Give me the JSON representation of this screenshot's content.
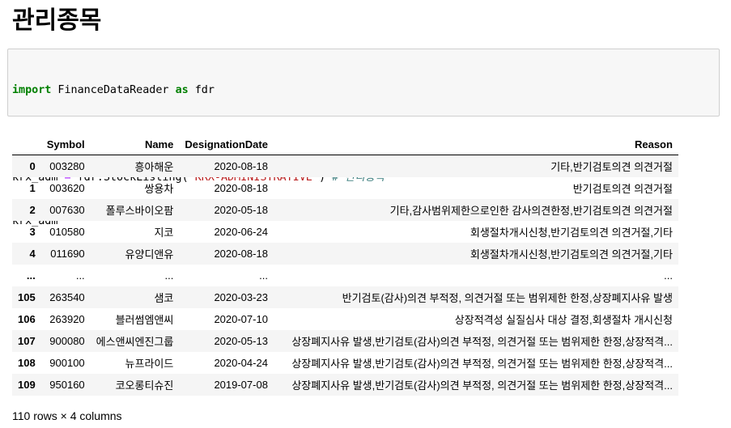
{
  "heading": "관리종목",
  "code": {
    "line1": {
      "kw": "import",
      "mod": " FinanceDataReader ",
      "kw2": "as",
      "alias": " fdr"
    },
    "line3": {
      "var": "krx_adm ",
      "eq": "=",
      "call": " fdr.StockListing(",
      "str": "'KRX-ADMINISTRATIVE'",
      "close": ") ",
      "comment": "# 관리종목"
    },
    "line4": "krx_adm"
  },
  "table": {
    "columns": [
      "",
      "Symbol",
      "Name",
      "DesignationDate",
      "Reason"
    ],
    "rows": [
      {
        "idx": "0",
        "symbol": "003280",
        "name": "흥아해운",
        "date": "2020-08-18",
        "reason": "기타,반기검토의견 의견거절"
      },
      {
        "idx": "1",
        "symbol": "003620",
        "name": "쌍용차",
        "date": "2020-08-18",
        "reason": "반기검토의견 의견거절"
      },
      {
        "idx": "2",
        "symbol": "007630",
        "name": "폴루스바이오팜",
        "date": "2020-05-18",
        "reason": "기타,감사범위제한으로인한 감사의견한정,반기검토의견 의견거절"
      },
      {
        "idx": "3",
        "symbol": "010580",
        "name": "지코",
        "date": "2020-06-24",
        "reason": "회생절차개시신청,반기검토의견 의견거절,기타"
      },
      {
        "idx": "4",
        "symbol": "011690",
        "name": "유양디앤유",
        "date": "2020-08-18",
        "reason": "회생절차개시신청,반기검토의견 의견거절,기타"
      },
      {
        "idx": "...",
        "symbol": "...",
        "name": "...",
        "date": "...",
        "reason": "..."
      },
      {
        "idx": "105",
        "symbol": "263540",
        "name": "샘코",
        "date": "2020-03-23",
        "reason": "반기검토(감사)의견 부적정, 의견거절 또는 범위제한 한정,상장폐지사유 발생"
      },
      {
        "idx": "106",
        "symbol": "263920",
        "name": "블러썸엠앤씨",
        "date": "2020-07-10",
        "reason": "상장적격성 실질심사 대상 결정,회생절차 개시신청"
      },
      {
        "idx": "107",
        "symbol": "900080",
        "name": "에스앤씨엔진그룹",
        "date": "2020-05-13",
        "reason": "상장폐지사유 발생,반기검토(감사)의견 부적정, 의견거절 또는 범위제한 한정,상장적격..."
      },
      {
        "idx": "108",
        "symbol": "900100",
        "name": "뉴프라이드",
        "date": "2020-04-24",
        "reason": "상장폐지사유 발생,반기검토(감사)의견 부적정, 의견거절 또는 범위제한 한정,상장적격..."
      },
      {
        "idx": "109",
        "symbol": "950160",
        "name": "코오롱티슈진",
        "date": "2019-07-08",
        "reason": "상장폐지사유 발생,반기검토(감사)의견 부적정, 의견거절 또는 범위제한 한정,상장적격..."
      }
    ]
  },
  "footer": "110 rows × 4 columns"
}
